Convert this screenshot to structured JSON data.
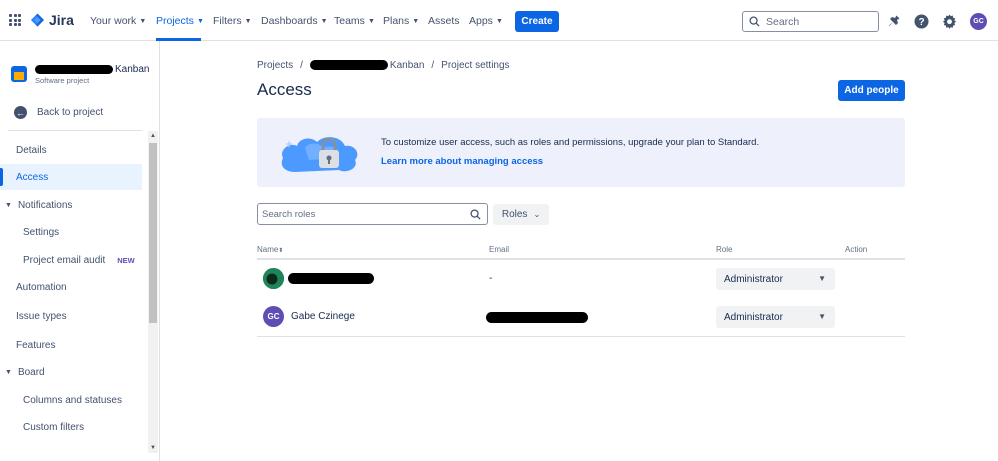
{
  "topnav": {
    "logo_text": "Jira",
    "items": [
      {
        "label": "Your work",
        "chevron": true
      },
      {
        "label": "Projects",
        "chevron": true
      },
      {
        "label": "Filters",
        "chevron": true
      },
      {
        "label": "Dashboards",
        "chevron": true
      },
      {
        "label": "Teams",
        "chevron": true
      },
      {
        "label": "Plans",
        "chevron": true
      },
      {
        "label": "Assets",
        "chevron": false
      },
      {
        "label": "Apps",
        "chevron": true
      }
    ],
    "create_label": "Create",
    "search_placeholder": "Search",
    "avatar_initials": "GC",
    "icons": [
      "apps-grid-icon",
      "jira-logo-icon",
      "search-icon",
      "notifications-icon",
      "help-icon",
      "settings-icon"
    ],
    "accent_color": "#0c66e4"
  },
  "sidebar": {
    "project_name_suffix": "Kanban",
    "project_type": "Software project",
    "back_label": "Back to project",
    "items": [
      {
        "label": "Details"
      },
      {
        "label": "Access"
      },
      {
        "label": "Notifications"
      },
      {
        "label": "Settings"
      },
      {
        "label": "Project email audit",
        "badge": "NEW"
      },
      {
        "label": "Automation"
      },
      {
        "label": "Issue types"
      },
      {
        "label": "Features"
      },
      {
        "label": "Board"
      },
      {
        "label": "Columns and statuses"
      },
      {
        "label": "Custom filters"
      }
    ],
    "active_item": "Access"
  },
  "main": {
    "breadcrumb": {
      "projects": "Projects",
      "project_suffix": "Kanban",
      "settings": "Project settings",
      "separator": "/"
    },
    "title": "Access",
    "add_people_label": "Add people",
    "banner": {
      "message": "To customize user access, such as roles and permissions, upgrade your plan to Standard.",
      "link": "Learn more about managing access"
    },
    "search_roles_placeholder": "Search roles",
    "roles_filter_label": "Roles",
    "table": {
      "headers": {
        "name": "Name",
        "email": "Email",
        "role": "Role",
        "action": "Action"
      },
      "rows": [
        {
          "name": "",
          "email": "-",
          "role": "Administrator",
          "avatar_initials": ""
        },
        {
          "name": "Gabe Czinege",
          "email": "",
          "role": "Administrator",
          "avatar_initials": "GC"
        }
      ]
    }
  }
}
